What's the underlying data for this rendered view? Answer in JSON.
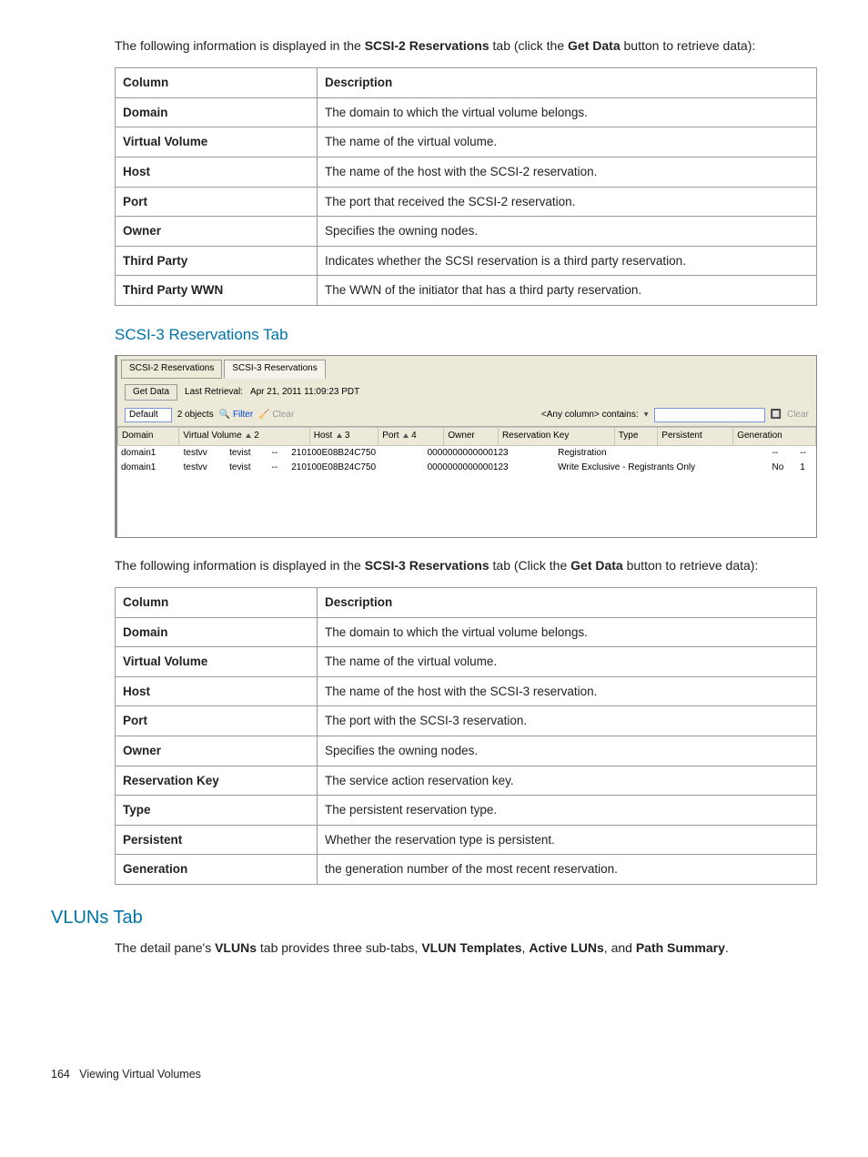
{
  "para1": {
    "pre": "The following information is displayed in the ",
    "bold1": "SCSI-2 Reservations",
    "mid": " tab (click the ",
    "bold2": "Get Data",
    "post": " button to retrieve data):"
  },
  "table1": {
    "headers": [
      "Column",
      "Description"
    ],
    "rows": [
      [
        "Domain",
        "The domain to which the virtual volume belongs."
      ],
      [
        "Virtual Volume",
        "The name of the virtual volume."
      ],
      [
        "Host",
        "The name of the host with the SCSI-2 reservation."
      ],
      [
        "Port",
        "The port that received the SCSI-2 reservation."
      ],
      [
        "Owner",
        "Specifies the owning nodes."
      ],
      [
        "Third Party",
        "Indicates whether the SCSI reservation is a third party reservation."
      ],
      [
        "Third Party WWN",
        "The WWN of the initiator that has a third party reservation."
      ]
    ]
  },
  "section_scsi3": "SCSI-3 Reservations Tab",
  "screenshot": {
    "tabs": [
      "SCSI-2 Reservations",
      "SCSI-3 Reservations"
    ],
    "active_tab_index": 1,
    "get_data": "Get Data",
    "last_retrieval_label": "Last Retrieval:",
    "last_retrieval_value": "Apr 21, 2011 11:09:23 PDT",
    "filter_default": "Default",
    "object_count": "2 objects",
    "filter_label": "Filter",
    "clear_label": "Clear",
    "search_label": "<Any column> contains:",
    "search_clear": "Clear",
    "columns": [
      "Domain",
      "Virtual Volume",
      "Host",
      "Port",
      "Owner",
      "Reservation Key",
      "Type",
      "Persistent",
      "Generation"
    ],
    "sort_indices": {
      "1": "2",
      "2": "3",
      "3": "4"
    },
    "rows": [
      {
        "domain": "domain1",
        "vv": "testvv",
        "host": "tevist",
        "port": "--",
        "owner": "210100E08B24C750",
        "rkey": "0000000000000123",
        "type": "Registration",
        "persistent": "--",
        "generation": "--"
      },
      {
        "domain": "domain1",
        "vv": "testvv",
        "host": "tevist",
        "port": "--",
        "owner": "210100E08B24C750",
        "rkey": "0000000000000123",
        "type": "Write Exclusive - Registrants Only",
        "persistent": "No",
        "generation": "1"
      }
    ]
  },
  "para2": {
    "pre": "The following information is displayed in the ",
    "bold1": "SCSI-3 Reservations",
    "mid": " tab (Click the ",
    "bold2": "Get Data",
    "post": " button to retrieve data):"
  },
  "table2": {
    "headers": [
      "Column",
      "Description"
    ],
    "rows": [
      [
        "Domain",
        "The domain to which the virtual volume belongs."
      ],
      [
        "Virtual Volume",
        "The name of the virtual volume."
      ],
      [
        "Host",
        "The name of the host with the SCSI-3 reservation."
      ],
      [
        "Port",
        "The port with the SCSI-3 reservation."
      ],
      [
        "Owner",
        "Specifies the owning nodes."
      ],
      [
        "Reservation Key",
        "The service action reservation key."
      ],
      [
        "Type",
        "The persistent reservation type."
      ],
      [
        "Persistent",
        "Whether the reservation type is persistent."
      ],
      [
        "Generation",
        "the generation number of the most recent reservation."
      ]
    ]
  },
  "section_vluns": "VLUNs Tab",
  "vluns_para": {
    "pre": "The detail pane's ",
    "b1": "VLUNs",
    "mid1": " tab provides three sub-tabs, ",
    "b2": "VLUN Templates",
    "sep1": ", ",
    "b3": "Active LUNs",
    "sep2": ", and ",
    "b4": "Path Summary",
    "post": "."
  },
  "footer": {
    "page": "164",
    "title": "Viewing Virtual Volumes"
  }
}
